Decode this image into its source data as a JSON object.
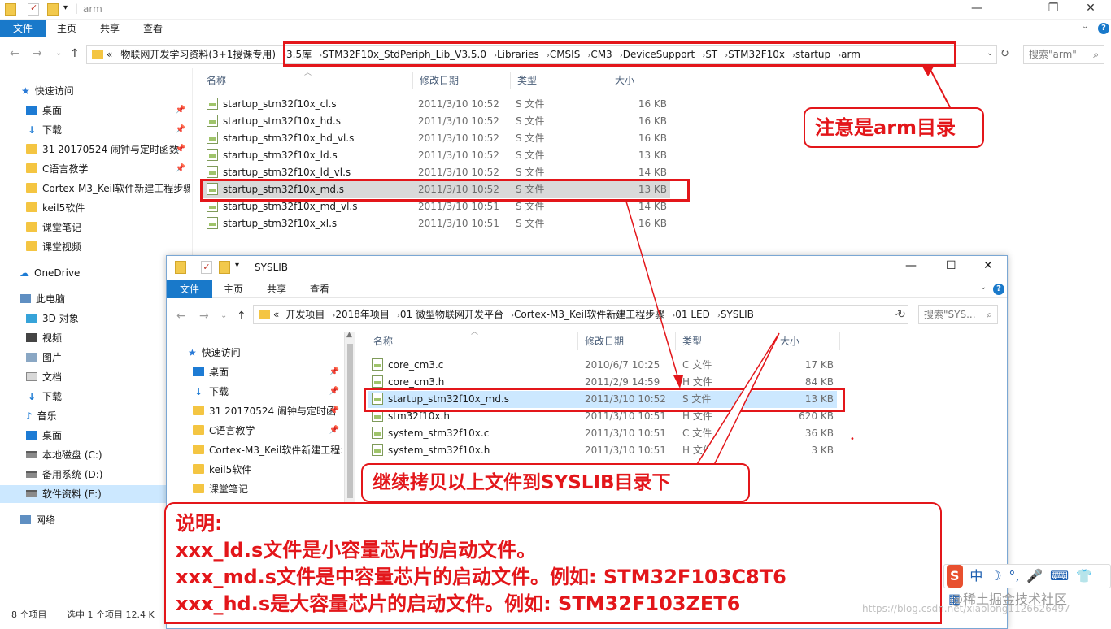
{
  "back_window": {
    "title": "arm",
    "ribbon_tabs": [
      "文件",
      "主页",
      "共享",
      "查看"
    ],
    "breadcrumb": [
      "«",
      "物联网开发学习资料(3+1授课专用)",
      "3.5库",
      "STM32F10x_StdPeriph_Lib_V3.5.0",
      "Libraries",
      "CMSIS",
      "CM3",
      "DeviceSupport",
      "ST",
      "STM32F10x",
      "startup",
      "arm"
    ],
    "search_placeholder": "搜索\"arm\"",
    "sidebar": [
      {
        "label": "快速访问",
        "icon": "star-icon"
      },
      {
        "label": "桌面",
        "icon": "desktop-icon",
        "pinned": true
      },
      {
        "label": "下载",
        "icon": "download-icon",
        "pinned": true
      },
      {
        "label": "31 20170524  闹钟与定时函数",
        "icon": "folder-icon",
        "pinned": true
      },
      {
        "label": "C语言教学",
        "icon": "folder-icon",
        "pinned": true
      },
      {
        "label": "Cortex-M3_Keil软件新建工程步骤",
        "icon": "folder-icon"
      },
      {
        "label": "keil5软件",
        "icon": "folder-icon"
      },
      {
        "label": "课堂笔记",
        "icon": "folder-icon"
      },
      {
        "label": "课堂视频",
        "icon": "folder-icon"
      },
      {
        "label": "OneDrive",
        "icon": "cloud-icon"
      },
      {
        "label": "此电脑",
        "icon": "computer-icon"
      },
      {
        "label": "3D 对象",
        "icon": "cube-icon"
      },
      {
        "label": "视频",
        "icon": "video-icon"
      },
      {
        "label": "图片",
        "icon": "picture-icon"
      },
      {
        "label": "文档",
        "icon": "document-icon"
      },
      {
        "label": "下载",
        "icon": "download-icon"
      },
      {
        "label": "音乐",
        "icon": "music-icon"
      },
      {
        "label": "桌面",
        "icon": "desktop-icon"
      },
      {
        "label": "本地磁盘 (C:)",
        "icon": "drive-icon"
      },
      {
        "label": "备用系统 (D:)",
        "icon": "drive-icon"
      },
      {
        "label": "软件资料 (E:)",
        "icon": "drive-icon",
        "selected": true
      },
      {
        "label": "网络",
        "icon": "network-icon"
      }
    ],
    "columns": [
      "名称",
      "修改日期",
      "类型",
      "大小"
    ],
    "files": [
      {
        "name": "startup_stm32f10x_cl.s",
        "date": "2011/3/10 10:52",
        "type": "S 文件",
        "size": "16 KB"
      },
      {
        "name": "startup_stm32f10x_hd.s",
        "date": "2011/3/10 10:52",
        "type": "S 文件",
        "size": "16 KB"
      },
      {
        "name": "startup_stm32f10x_hd_vl.s",
        "date": "2011/3/10 10:52",
        "type": "S 文件",
        "size": "16 KB"
      },
      {
        "name": "startup_stm32f10x_ld.s",
        "date": "2011/3/10 10:52",
        "type": "S 文件",
        "size": "13 KB"
      },
      {
        "name": "startup_stm32f10x_ld_vl.s",
        "date": "2011/3/10 10:52",
        "type": "S 文件",
        "size": "14 KB"
      },
      {
        "name": "startup_stm32f10x_md.s",
        "date": "2011/3/10 10:52",
        "type": "S 文件",
        "size": "13 KB"
      },
      {
        "name": "startup_stm32f10x_md_vl.s",
        "date": "2011/3/10 10:51",
        "type": "S 文件",
        "size": "14 KB"
      },
      {
        "name": "startup_stm32f10x_xl.s",
        "date": "2011/3/10 10:51",
        "type": "S 文件",
        "size": "16 KB"
      }
    ],
    "selected_index": 5,
    "status": {
      "count": "8 个项目",
      "selected": "选中 1 个项目  12.4 K"
    }
  },
  "front_window": {
    "title": "SYSLIB",
    "ribbon_tabs": [
      "文件",
      "主页",
      "共享",
      "查看"
    ],
    "breadcrumb": [
      "«",
      "开发项目",
      "2018年项目",
      "01 微型物联网开发平台",
      "Cortex-M3_Keil软件新建工程步骤",
      "01 LED",
      "SYSLIB"
    ],
    "search_placeholder": "搜索\"SYS...",
    "sidebar": [
      {
        "label": "快速访问",
        "icon": "star-icon"
      },
      {
        "label": "桌面",
        "icon": "desktop-icon",
        "pinned": true
      },
      {
        "label": "下载",
        "icon": "download-icon",
        "pinned": true
      },
      {
        "label": "31 20170524  闹钟与定时函",
        "icon": "folder-icon",
        "pinned": true
      },
      {
        "label": "C语言教学",
        "icon": "folder-icon",
        "pinned": true
      },
      {
        "label": "Cortex-M3_Keil软件新建工程:",
        "icon": "folder-icon"
      },
      {
        "label": "keil5软件",
        "icon": "folder-icon"
      },
      {
        "label": "课堂笔记",
        "icon": "folder-icon"
      }
    ],
    "columns": [
      "名称",
      "修改日期",
      "类型",
      "大小"
    ],
    "files": [
      {
        "name": "core_cm3.c",
        "date": "2010/6/7 10:25",
        "type": "C 文件",
        "size": "17 KB"
      },
      {
        "name": "core_cm3.h",
        "date": "2011/2/9 14:59",
        "type": "H 文件",
        "size": "84 KB"
      },
      {
        "name": "startup_stm32f10x_md.s",
        "date": "2011/3/10 10:52",
        "type": "S 文件",
        "size": "13 KB"
      },
      {
        "name": "stm32f10x.h",
        "date": "2011/3/10 10:51",
        "type": "H 文件",
        "size": "620 KB"
      },
      {
        "name": "system_stm32f10x.c",
        "date": "2011/3/10 10:51",
        "type": "C 文件",
        "size": "36 KB"
      },
      {
        "name": "system_stm32f10x.h",
        "date": "2011/3/10 10:51",
        "type": "H 文件",
        "size": "3 KB"
      }
    ],
    "selected_index": 2
  },
  "annotations": {
    "arm_note": "注意是arm目录",
    "copy_note": "继续拷贝以上文件到SYSLIB目录下",
    "explain": [
      "说明:",
      "xxx_ld.s文件是小容量芯片的启动文件。",
      "xxx_md.s文件是中容量芯片的启动文件。例如: STM32F103C8T6",
      "xxx_hd.s是大容量芯片的启动文件。例如: STM32F103ZET6"
    ],
    "color": "#e3161a"
  },
  "watermark": "@稀土掘金技术社区",
  "watermark_url": "https://blog.csdn.net/xiaolong1126626497"
}
